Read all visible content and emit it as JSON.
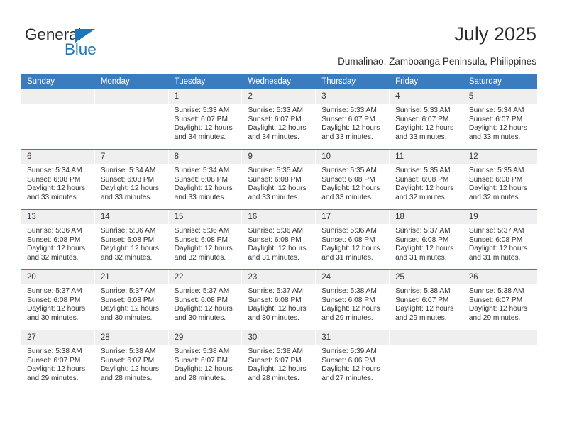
{
  "brand": {
    "name_top": "General",
    "name_bottom": "Blue",
    "triangle_color": "#1b76bc",
    "text_color": "#2b2b2b"
  },
  "header": {
    "title": "July 2025",
    "subtitle": "Dumalinao, Zamboanga Peninsula, Philippines"
  },
  "theme": {
    "header_blue": "#3a7cbe",
    "daynum_band": "#efefef",
    "text": "#333333",
    "page_background": "#ffffff"
  },
  "calendar": {
    "weekday_headers": [
      "Sunday",
      "Monday",
      "Tuesday",
      "Wednesday",
      "Thursday",
      "Friday",
      "Saturday"
    ],
    "labels": {
      "sunrise": "Sunrise:",
      "sunset": "Sunset:",
      "daylight": "Daylight:"
    },
    "weeks": [
      [
        {
          "day": "",
          "empty": true
        },
        {
          "day": "",
          "empty": true
        },
        {
          "day": "1",
          "sunrise": "Sunrise: 5:33 AM",
          "sunset": "Sunset: 6:07 PM",
          "daylight": "Daylight: 12 hours and 34 minutes."
        },
        {
          "day": "2",
          "sunrise": "Sunrise: 5:33 AM",
          "sunset": "Sunset: 6:07 PM",
          "daylight": "Daylight: 12 hours and 34 minutes."
        },
        {
          "day": "3",
          "sunrise": "Sunrise: 5:33 AM",
          "sunset": "Sunset: 6:07 PM",
          "daylight": "Daylight: 12 hours and 33 minutes."
        },
        {
          "day": "4",
          "sunrise": "Sunrise: 5:33 AM",
          "sunset": "Sunset: 6:07 PM",
          "daylight": "Daylight: 12 hours and 33 minutes."
        },
        {
          "day": "5",
          "sunrise": "Sunrise: 5:34 AM",
          "sunset": "Sunset: 6:07 PM",
          "daylight": "Daylight: 12 hours and 33 minutes."
        }
      ],
      [
        {
          "day": "6",
          "sunrise": "Sunrise: 5:34 AM",
          "sunset": "Sunset: 6:08 PM",
          "daylight": "Daylight: 12 hours and 33 minutes."
        },
        {
          "day": "7",
          "sunrise": "Sunrise: 5:34 AM",
          "sunset": "Sunset: 6:08 PM",
          "daylight": "Daylight: 12 hours and 33 minutes."
        },
        {
          "day": "8",
          "sunrise": "Sunrise: 5:34 AM",
          "sunset": "Sunset: 6:08 PM",
          "daylight": "Daylight: 12 hours and 33 minutes."
        },
        {
          "day": "9",
          "sunrise": "Sunrise: 5:35 AM",
          "sunset": "Sunset: 6:08 PM",
          "daylight": "Daylight: 12 hours and 33 minutes."
        },
        {
          "day": "10",
          "sunrise": "Sunrise: 5:35 AM",
          "sunset": "Sunset: 6:08 PM",
          "daylight": "Daylight: 12 hours and 33 minutes."
        },
        {
          "day": "11",
          "sunrise": "Sunrise: 5:35 AM",
          "sunset": "Sunset: 6:08 PM",
          "daylight": "Daylight: 12 hours and 32 minutes."
        },
        {
          "day": "12",
          "sunrise": "Sunrise: 5:35 AM",
          "sunset": "Sunset: 6:08 PM",
          "daylight": "Daylight: 12 hours and 32 minutes."
        }
      ],
      [
        {
          "day": "13",
          "sunrise": "Sunrise: 5:36 AM",
          "sunset": "Sunset: 6:08 PM",
          "daylight": "Daylight: 12 hours and 32 minutes."
        },
        {
          "day": "14",
          "sunrise": "Sunrise: 5:36 AM",
          "sunset": "Sunset: 6:08 PM",
          "daylight": "Daylight: 12 hours and 32 minutes."
        },
        {
          "day": "15",
          "sunrise": "Sunrise: 5:36 AM",
          "sunset": "Sunset: 6:08 PM",
          "daylight": "Daylight: 12 hours and 32 minutes."
        },
        {
          "day": "16",
          "sunrise": "Sunrise: 5:36 AM",
          "sunset": "Sunset: 6:08 PM",
          "daylight": "Daylight: 12 hours and 31 minutes."
        },
        {
          "day": "17",
          "sunrise": "Sunrise: 5:36 AM",
          "sunset": "Sunset: 6:08 PM",
          "daylight": "Daylight: 12 hours and 31 minutes."
        },
        {
          "day": "18",
          "sunrise": "Sunrise: 5:37 AM",
          "sunset": "Sunset: 6:08 PM",
          "daylight": "Daylight: 12 hours and 31 minutes."
        },
        {
          "day": "19",
          "sunrise": "Sunrise: 5:37 AM",
          "sunset": "Sunset: 6:08 PM",
          "daylight": "Daylight: 12 hours and 31 minutes."
        }
      ],
      [
        {
          "day": "20",
          "sunrise": "Sunrise: 5:37 AM",
          "sunset": "Sunset: 6:08 PM",
          "daylight": "Daylight: 12 hours and 30 minutes."
        },
        {
          "day": "21",
          "sunrise": "Sunrise: 5:37 AM",
          "sunset": "Sunset: 6:08 PM",
          "daylight": "Daylight: 12 hours and 30 minutes."
        },
        {
          "day": "22",
          "sunrise": "Sunrise: 5:37 AM",
          "sunset": "Sunset: 6:08 PM",
          "daylight": "Daylight: 12 hours and 30 minutes."
        },
        {
          "day": "23",
          "sunrise": "Sunrise: 5:37 AM",
          "sunset": "Sunset: 6:08 PM",
          "daylight": "Daylight: 12 hours and 30 minutes."
        },
        {
          "day": "24",
          "sunrise": "Sunrise: 5:38 AM",
          "sunset": "Sunset: 6:08 PM",
          "daylight": "Daylight: 12 hours and 29 minutes."
        },
        {
          "day": "25",
          "sunrise": "Sunrise: 5:38 AM",
          "sunset": "Sunset: 6:07 PM",
          "daylight": "Daylight: 12 hours and 29 minutes."
        },
        {
          "day": "26",
          "sunrise": "Sunrise: 5:38 AM",
          "sunset": "Sunset: 6:07 PM",
          "daylight": "Daylight: 12 hours and 29 minutes."
        }
      ],
      [
        {
          "day": "27",
          "sunrise": "Sunrise: 5:38 AM",
          "sunset": "Sunset: 6:07 PM",
          "daylight": "Daylight: 12 hours and 29 minutes."
        },
        {
          "day": "28",
          "sunrise": "Sunrise: 5:38 AM",
          "sunset": "Sunset: 6:07 PM",
          "daylight": "Daylight: 12 hours and 28 minutes."
        },
        {
          "day": "29",
          "sunrise": "Sunrise: 5:38 AM",
          "sunset": "Sunset: 6:07 PM",
          "daylight": "Daylight: 12 hours and 28 minutes."
        },
        {
          "day": "30",
          "sunrise": "Sunrise: 5:38 AM",
          "sunset": "Sunset: 6:07 PM",
          "daylight": "Daylight: 12 hours and 28 minutes."
        },
        {
          "day": "31",
          "sunrise": "Sunrise: 5:39 AM",
          "sunset": "Sunset: 6:06 PM",
          "daylight": "Daylight: 12 hours and 27 minutes."
        },
        {
          "day": "",
          "empty": true
        },
        {
          "day": "",
          "empty": true
        }
      ]
    ]
  }
}
